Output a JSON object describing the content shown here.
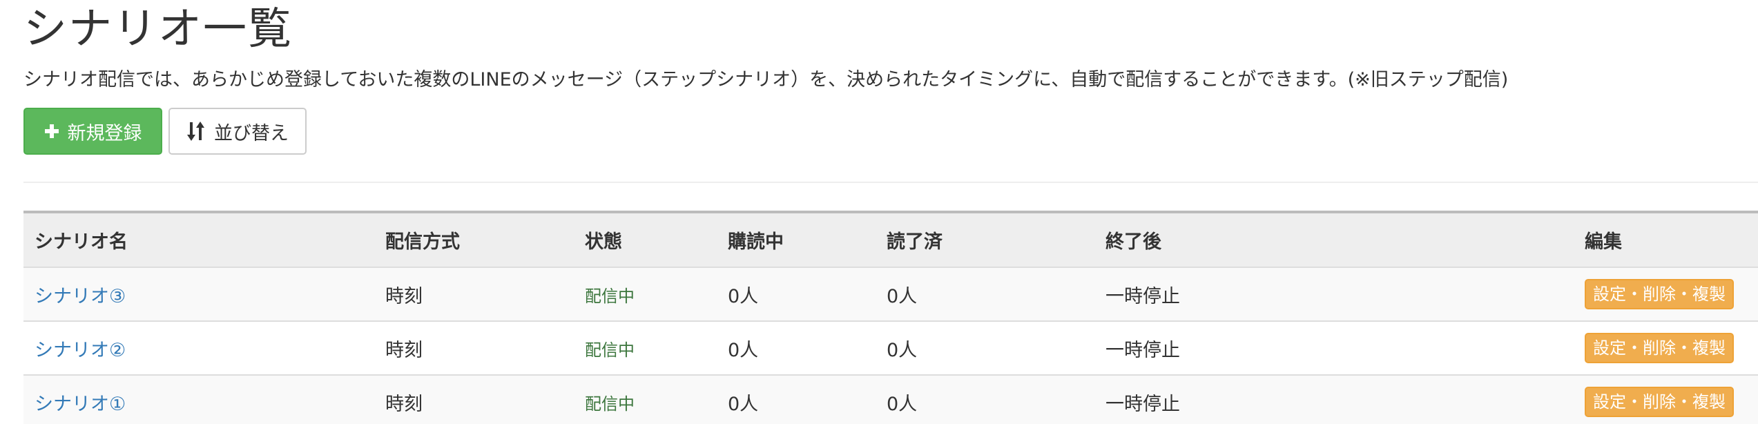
{
  "page": {
    "title": "シナリオ一覧",
    "description": "シナリオ配信では、あらかじめ登録しておいた複数のLINEのメッセージ（ステップシナリオ）を、決められたタイミングに、自動で配信することができます。(※旧ステップ配信)"
  },
  "toolbar": {
    "new_label": "新規登録",
    "sort_label": "並び替え"
  },
  "colors": {
    "success": "#5cb85c",
    "link": "#337ab7",
    "status": "#3c763d",
    "warning": "#f0ad4e"
  },
  "table": {
    "headers": [
      "シナリオ名",
      "配信方式",
      "状態",
      "購読中",
      "読了済",
      "終了後",
      "編集"
    ],
    "rows": [
      {
        "name": "シナリオ③",
        "method": "時刻",
        "status": "配信中",
        "subscribing": "0人",
        "completed": "0人",
        "after_end": "一時停止",
        "edit": "設定・削除・複製"
      },
      {
        "name": "シナリオ②",
        "method": "時刻",
        "status": "配信中",
        "subscribing": "0人",
        "completed": "0人",
        "after_end": "一時停止",
        "edit": "設定・削除・複製"
      },
      {
        "name": "シナリオ①",
        "method": "時刻",
        "status": "配信中",
        "subscribing": "0人",
        "completed": "0人",
        "after_end": "一時停止",
        "edit": "設定・削除・複製"
      }
    ]
  }
}
